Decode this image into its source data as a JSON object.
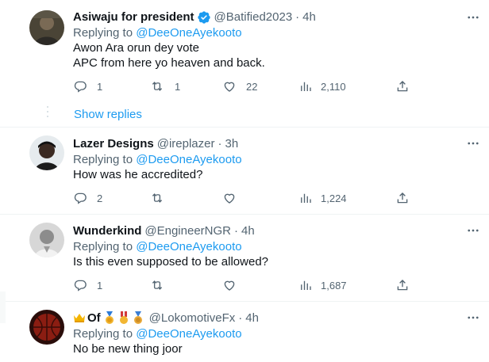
{
  "colors": {
    "accent": "#1d9bf0",
    "secondary_text": "#536471",
    "primary_text": "#0f1419",
    "divider": "#eff3f4"
  },
  "tweets": [
    {
      "display_name": "Asiwaju for president",
      "verified": true,
      "handle": "@Batified2023",
      "separator": "·",
      "time": "4h",
      "replying_prefix": "Replying to",
      "replying_to": "@DeeOneAyekooto",
      "text_lines": [
        "Awon Ara orun dey vote",
        "APC from here yo heaven and back."
      ],
      "stats": {
        "replies": "1",
        "retweets": "1",
        "likes": "22",
        "views": "2,110"
      }
    },
    {
      "display_name": "Lazer Designs",
      "handle": "@ireplazer",
      "separator": "·",
      "time": "3h",
      "replying_prefix": "Replying to",
      "replying_to": "@DeeOneAyekooto",
      "text_lines": [
        "How was he accredited?"
      ],
      "stats": {
        "replies": "2",
        "retweets": "",
        "likes": "",
        "views": "1,224"
      }
    },
    {
      "display_name": "Wunderkind",
      "handle": "@EngineerNGR",
      "separator": "·",
      "time": "4h",
      "replying_prefix": "Replying to",
      "replying_to": "@DeeOneAyekooto",
      "text_lines": [
        "Is this even supposed to be allowed?"
      ],
      "stats": {
        "replies": "1",
        "retweets": "",
        "likes": "",
        "views": "1,687"
      }
    },
    {
      "display_name": "Of",
      "name_emojis": [
        "crown-emoji",
        "first-place-medal-emoji",
        "military-medal-emoji",
        "sports-medal-emoji"
      ],
      "handle": "@LokomotiveFx",
      "separator": "·",
      "time": "4h",
      "replying_prefix": "Replying to",
      "replying_to": "@DeeOneAyekooto",
      "text_lines": [
        "No be new thing joor"
      ]
    }
  ],
  "show_replies_label": "Show replies",
  "icons": {
    "more": "more-horizontal-icon",
    "reply": "reply-bubble-icon",
    "retweet": "retweet-icon",
    "like": "heart-icon",
    "views": "views-bar-chart-icon",
    "share": "share-upload-icon",
    "verified": "verified-badge-icon"
  }
}
